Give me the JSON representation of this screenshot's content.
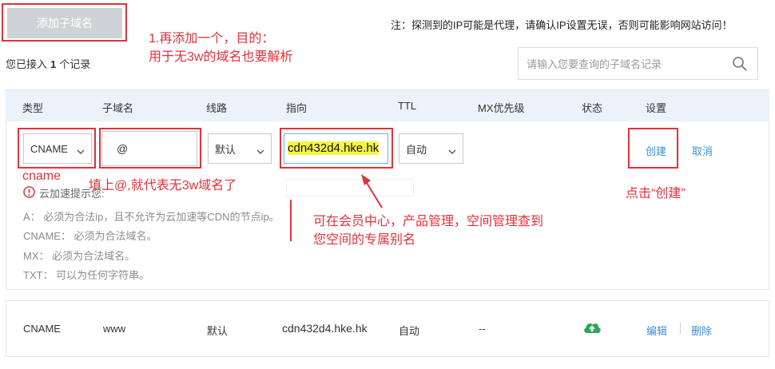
{
  "toolbar": {
    "add_subdomain_label": "添加子域名"
  },
  "notice": "注：探测到的IP可能是代理，请确认IP设置无误，否则可能影响网站访问！",
  "records": {
    "prefix": "您已接入",
    "count": "1",
    "suffix": "个记录"
  },
  "search": {
    "placeholder": "请输入您要查询的子域名记录"
  },
  "annotations": {
    "step1_line1": "1.再添加一个，目的：",
    "step1_line2": "用于无3w的域名也要解析",
    "cname_label": "cname",
    "fill_at": "填上@,就代表无3w域名了",
    "target_line1": "可在会员中心，产品管理，空间管理查到",
    "target_line2": "您空间的专属别名",
    "click_create": "点击“创建”"
  },
  "table": {
    "headers": [
      "类型",
      "子域名",
      "线路",
      "指向",
      "TTL",
      "MX优先级",
      "状态",
      "设置"
    ]
  },
  "edit_row": {
    "type": "CNAME",
    "subdomain": "@",
    "line": "默认",
    "target": "cdn432d4.hke.hk",
    "ttl": "自动",
    "create_label": "创建",
    "cancel_label": "取消"
  },
  "hints": {
    "title": "云加速提示您:",
    "a": "A： 必须为合法ip，且不允许为云加速等CDN的节点ip。",
    "cname": "CNAME： 必须为合法域名。",
    "mx": "MX： 必须为合法域名。",
    "txt": "TXT： 可以为任何字符串。"
  },
  "records_list": [
    {
      "type": "CNAME",
      "subdomain": "www",
      "line": "默认",
      "target": "cdn432d4.hke.hk",
      "ttl": "自动",
      "mx": "--",
      "status_icon": "cloud-upload-icon",
      "edit_label": "编辑",
      "delete_label": "删除"
    }
  ],
  "colors": {
    "annotation_red": "#e0323c",
    "link_blue": "#3d8fd6",
    "header_bg": "#eaf3fa",
    "status_green": "#2ea75a",
    "button_gray": "#cfd3d8"
  }
}
